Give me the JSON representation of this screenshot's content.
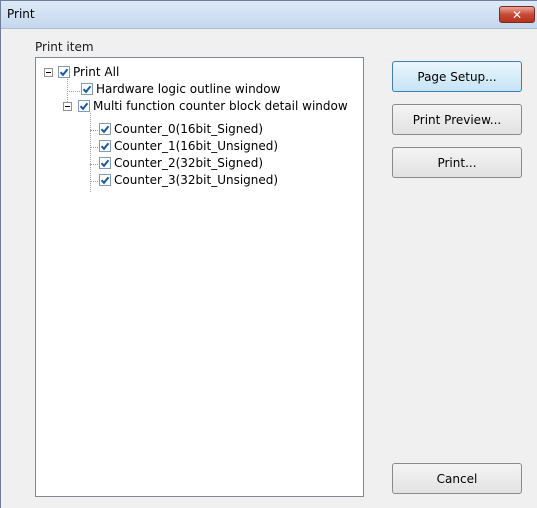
{
  "window": {
    "title": "Print",
    "close_glyph": "✕"
  },
  "group": {
    "label": "Print item"
  },
  "tree": {
    "root": {
      "label": "Print All",
      "checked": true
    },
    "hardware": {
      "label": "Hardware logic outline window",
      "checked": true
    },
    "multi": {
      "label": "Multi function counter block detail window",
      "checked": true
    },
    "counters": [
      {
        "label": "Counter_0(16bit_Signed)",
        "checked": true
      },
      {
        "label": "Counter_1(16bit_Unsigned)",
        "checked": true
      },
      {
        "label": "Counter_2(32bit_Signed)",
        "checked": true
      },
      {
        "label": "Counter_3(32bit_Unsigned)",
        "checked": true
      }
    ]
  },
  "buttons": {
    "page_setup": "Page Setup...",
    "print_preview": "Print Preview...",
    "print": "Print...",
    "cancel": "Cancel"
  },
  "colors": {
    "title_bar": "#c6d8ee",
    "close_button": "#c74a36",
    "check": "#1d5a9c"
  }
}
